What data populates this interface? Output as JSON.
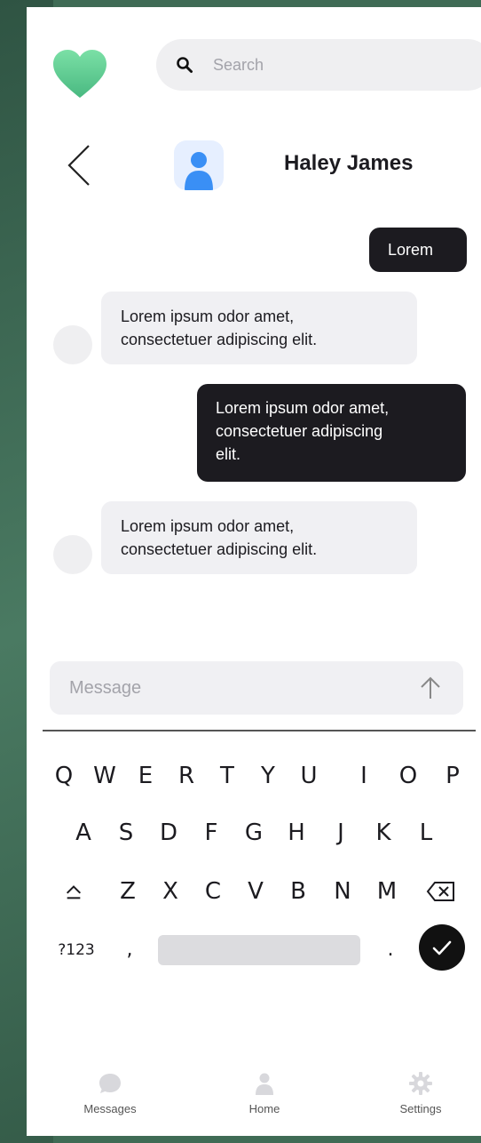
{
  "search": {
    "placeholder": "Search"
  },
  "chat": {
    "contact_name": "Haley James",
    "messages": [
      {
        "direction": "sent",
        "text": "Lorem"
      },
      {
        "direction": "received",
        "lines": [
          "Lorem ipsum odor amet,",
          "consectetuer adipiscing elit."
        ]
      },
      {
        "direction": "sent",
        "lines": [
          "Lorem ipsum odor amet,",
          "consectetuer adipiscing",
          "elit."
        ]
      },
      {
        "direction": "received",
        "lines": [
          "Lorem ipsum odor amet,",
          "consectetuer adipiscing elit."
        ]
      }
    ]
  },
  "composer": {
    "placeholder": "Message",
    "send_icon": "arrow-up-icon"
  },
  "keyboard": {
    "row1": [
      "Q",
      "W",
      "E",
      "R",
      "T",
      "Y",
      "U",
      "I",
      "O",
      "P"
    ],
    "row2": [
      "A",
      "S",
      "D",
      "F",
      "G",
      "H",
      "J",
      "K",
      "L"
    ],
    "row3": [
      "Z",
      "X",
      "C",
      "V",
      "B",
      "N",
      "M"
    ],
    "shift_symbol": "⌂",
    "numbers_key": "?123",
    "comma_key": ",",
    "period_key": ".",
    "done_icon": "checkmark-icon"
  },
  "nav": {
    "items": [
      {
        "label": "Messages",
        "icon": "chat-bubble-icon"
      },
      {
        "label": "Home",
        "icon": "person-icon"
      },
      {
        "label": "Settings",
        "icon": "gear-icon"
      }
    ]
  },
  "colors": {
    "background": "#3f6b55",
    "sent_bubble": "#1c1b20",
    "received_bubble": "#f0f0f3",
    "logo_heart": "#5cc98f"
  }
}
